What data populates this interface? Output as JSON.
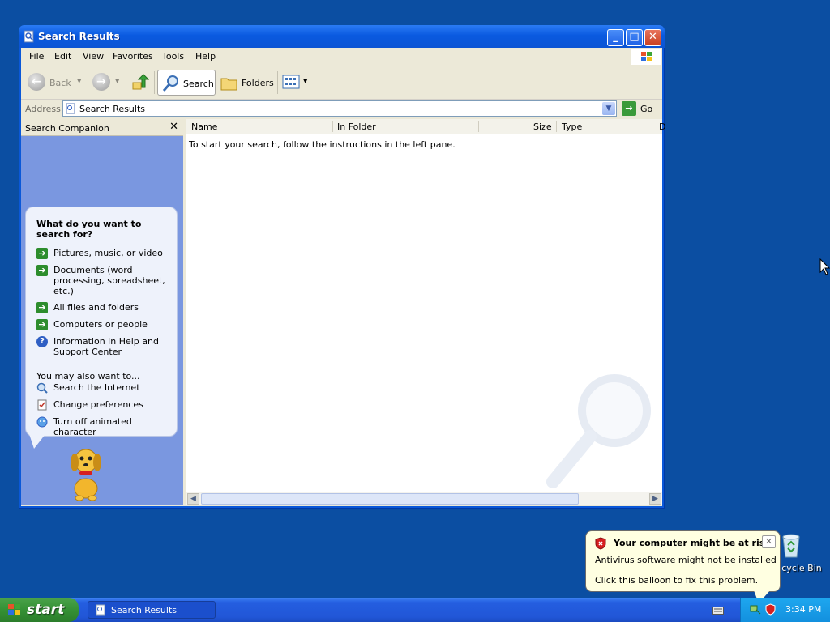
{
  "desktop": {
    "recycle_bin_label": "cycle Bin"
  },
  "window": {
    "title": "Search Results",
    "menu": [
      "File",
      "Edit",
      "View",
      "Favorites",
      "Tools",
      "Help"
    ],
    "toolbar": {
      "back": "Back",
      "search": "Search",
      "folders": "Folders"
    },
    "address": {
      "label": "Address",
      "value": "Search Results",
      "go": "Go"
    }
  },
  "search_companion": {
    "title": "Search Companion",
    "question": "What do you want to search for?",
    "options": [
      "Pictures, music, or video",
      "Documents (word processing, spreadsheet, etc.)",
      "All files and folders",
      "Computers or people",
      "Information in Help and Support Center"
    ],
    "also_label": "You may also want to...",
    "also_options": [
      "Search the Internet",
      "Change preferences",
      "Turn off animated character"
    ]
  },
  "results": {
    "columns": [
      "Name",
      "In Folder",
      "Size",
      "Type",
      "D"
    ],
    "instruction": "To start your search, follow the instructions in the left pane."
  },
  "notification": {
    "title": "Your computer might be at risk",
    "line1": "Antivirus software might not be installed",
    "line2": "Click this balloon to fix this problem."
  },
  "taskbar": {
    "start": "start",
    "task": "Search Results",
    "clock": "3:34 PM"
  },
  "colors": {
    "desktop": "#0b4ea2",
    "taskbar": "#245ee0",
    "pane": "#7a97e0",
    "start": "#359135"
  }
}
